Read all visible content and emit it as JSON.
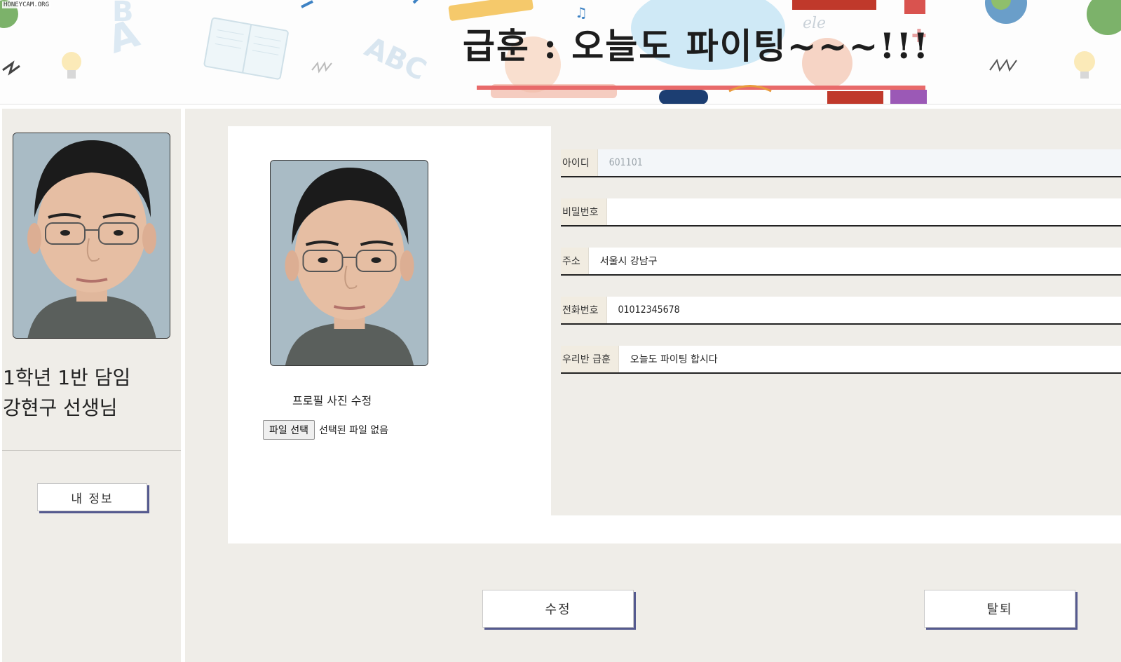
{
  "banner": {
    "title": "급훈 : 오늘도 파이팅~~~!!!",
    "watermark": "HONEYCAM.ORG"
  },
  "sidebar": {
    "class_line": "1학년 1반 담임",
    "name_line": "강현구 선생님",
    "my_info_button": "내 정보"
  },
  "profile": {
    "photo_label": "프로필 사진 수정",
    "file_button": "파일 선택",
    "file_status": "선택된 파일 없음"
  },
  "form": {
    "fields": [
      {
        "label": "아이디",
        "value": "601101",
        "placeholder": ""
      },
      {
        "label": "비밀번호",
        "value": "",
        "placeholder": ""
      },
      {
        "label": "주소",
        "value": "서울시 강남구",
        "placeholder": ""
      },
      {
        "label": "전화번호",
        "value": "01012345678",
        "placeholder": ""
      },
      {
        "label": "우리반 급훈",
        "value": "오늘도 파이팅 합시다",
        "placeholder": ""
      }
    ]
  },
  "actions": {
    "edit_button": "수정",
    "leave_button": "탈퇴"
  },
  "colors": {
    "page_background": "#efede8",
    "card_background": "#ffffff",
    "button_shadow": "#555a8f",
    "label_background": "#f1ece1"
  }
}
